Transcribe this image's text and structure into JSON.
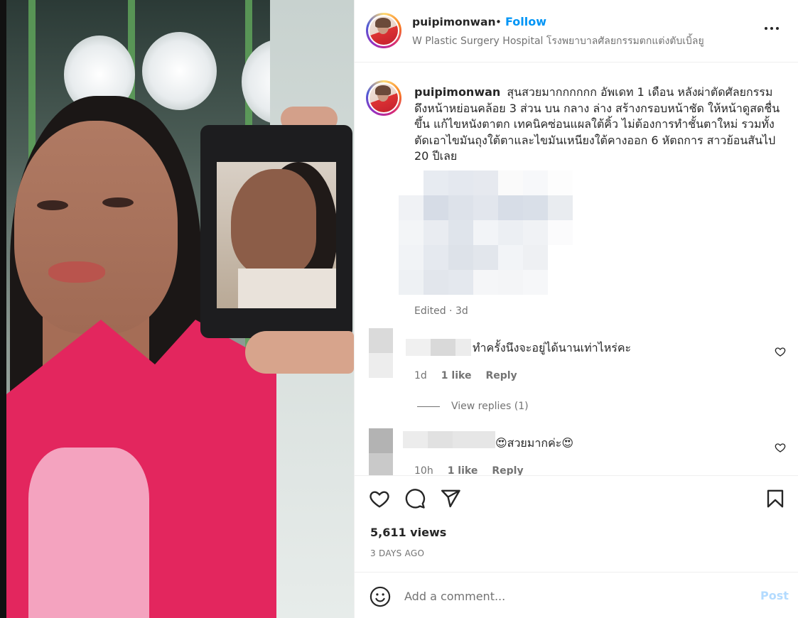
{
  "header": {
    "username": "puipimonwan",
    "separator": "•",
    "follow_label": "Follow",
    "location": "W Plastic Surgery Hospital โรงพยาบาลศัลยกรรมตกแต่งตับเบิ้ลยู",
    "more_icon": "more-horizontal-icon"
  },
  "caption": {
    "username": "puipimonwan",
    "text": "สุนสวยมากกกกกก อัพเดท 1 เดือน หลังผ่าตัดศัลยกรรมดึงหน้าหย่อนคล้อย 3 ส่วน บน กลาง ล่าง สร้างกรอบหน้าชัด ให้หน้าดูสดชื่นขึ้น แก้ไขหนังตาตก เทคนิคซ่อนแผลใต้คิ้ว ไม่ต้องการทำชั้นตาใหม่ รวมทั้งตัดเอาไขมันถุงใต้ตาและไขมันเหนียงใต้คางออก 6 หัตถการ สาวย้อนสันไป 20 ปีเลย",
    "edited": "Edited · 3d"
  },
  "comments": [
    {
      "text": "ทำครั้งนึงจะอยู่ได้นานเท่าไหร่คะ",
      "time": "1d",
      "likes": "1 like",
      "reply_label": "Reply",
      "view_replies": "View replies (1)"
    },
    {
      "text": "😍สวยมากค่ะ😍",
      "time": "10h",
      "likes": "1 like",
      "reply_label": "Reply"
    }
  ],
  "actions": {
    "like_icon": "heart-icon",
    "comment_icon": "comment-bubble-icon",
    "share_icon": "paper-plane-icon",
    "save_icon": "bookmark-icon"
  },
  "stats": {
    "views": "5,611 views",
    "time_ago": "3 DAYS AGO"
  },
  "add_comment": {
    "placeholder": "Add a comment...",
    "post_label": "Post"
  },
  "colors": {
    "follow": "#0095f6",
    "post_disabled": "#b3dbff",
    "secondary_text": "#737373"
  }
}
